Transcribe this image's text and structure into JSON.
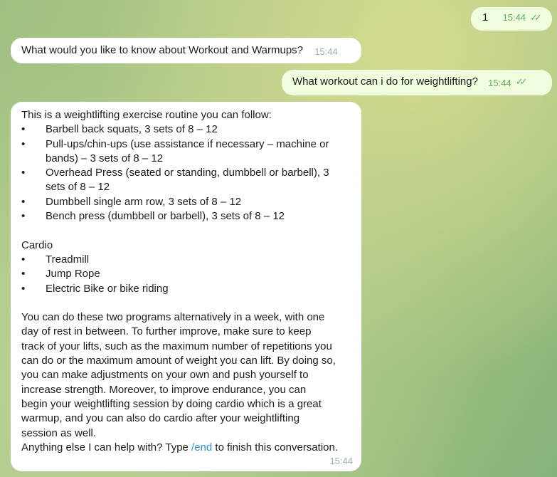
{
  "messages": [
    {
      "direction": "out",
      "text": "1",
      "time": "15:44",
      "status": "read"
    },
    {
      "direction": "in",
      "text": "What would you like to know about Workout and Warmups?",
      "time": "15:44"
    },
    {
      "direction": "out",
      "text": "What workout can i do for weightlifting?",
      "time": "15:44",
      "status": "read"
    },
    {
      "direction": "in",
      "time": "15:44",
      "intro": "This is a weightlifting exercise routine you can follow:",
      "routine_lines": [
        {
          "bullet": "•",
          "text": "Barbell back squats, 3 sets of 8 – 12"
        },
        {
          "bullet": "•",
          "text": "Pull-ups/chin-ups (use assistance if necessary – machine or"
        },
        {
          "bullet": "",
          "text": "bands) – 3 sets of 8 – 12"
        },
        {
          "bullet": "•",
          "text": "Overhead Press (seated or standing, dumbbell or barbell), 3"
        },
        {
          "bullet": "",
          "text": "sets of 8 – 12"
        },
        {
          "bullet": "•",
          "text": "Dumbbell single arm row, 3 sets of 8 – 12"
        },
        {
          "bullet": "•",
          "text": "Bench press (dumbbell or barbell), 3 sets of 8 – 12"
        }
      ],
      "cardio_title": "Cardio",
      "cardio_items": [
        "Treadmill",
        "Jump Rope",
        "Electric Bike or bike riding"
      ],
      "bullet": "•",
      "paragraph_lines": [
        "You can do these two programs alternatively in a week, with one",
        "day of rest in between. To further improve, make sure to keep",
        "track of your lifts, such as the maximum number of repetitions you",
        "can do or the maximum amount of weight you can lift. By doing so,",
        "you can make adjustments on your own and push yourself to",
        "increase strength.  Moreover, to improve endurance, you can",
        "begin your weightlifting session by doing cardio which is a great",
        "warmup, and you can also do cardio after your weightlifting",
        "session as well."
      ],
      "closing_before": "Anything else I can help with? Type ",
      "closing_command": "/end",
      "closing_after": " to finish this conversation."
    }
  ],
  "check_icon": "✓✓"
}
